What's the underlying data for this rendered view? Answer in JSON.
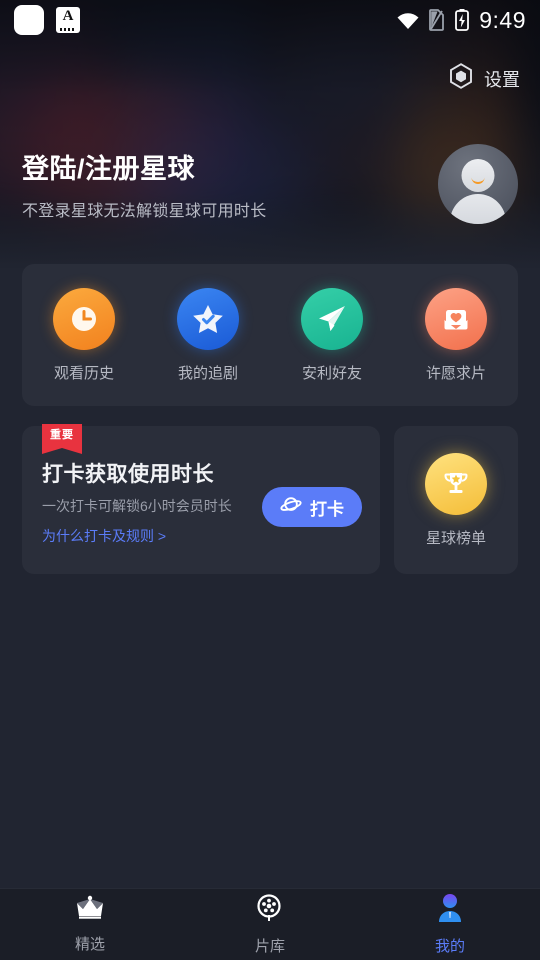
{
  "status_bar": {
    "time": "9:49",
    "icons": [
      "app-white-square-icon",
      "app-a-icon",
      "wifi-icon",
      "sim-off-icon",
      "battery-charging-icon"
    ]
  },
  "header": {
    "settings_label": "设置",
    "settings_icon": "hexagon-gear-icon"
  },
  "login": {
    "title": "登陆/注册星球",
    "subtitle": "不登录星球无法解锁星球可用时长",
    "avatar_icon": "default-avatar-icon"
  },
  "quick_actions": [
    {
      "label": "观看历史",
      "icon": "clock-icon",
      "color": "#f4912a"
    },
    {
      "label": "我的追剧",
      "icon": "star-check-icon",
      "color": "#2a72e8"
    },
    {
      "label": "安利好友",
      "icon": "paper-plane-icon",
      "color": "#25c4a0"
    },
    {
      "label": "许愿求片",
      "icon": "envelope-heart-icon",
      "color": "#f6835c"
    }
  ],
  "checkin": {
    "badge": "重要",
    "title": "打卡获取使用时长",
    "subtitle": "一次打卡可解锁6小时会员时长",
    "link": "为什么打卡及规则 >",
    "button_label": "打卡",
    "button_icon": "planet-icon",
    "button_color": "#5b7cf8"
  },
  "ranking": {
    "label": "星球榜单",
    "icon": "trophy-icon",
    "color": "#f5c53c"
  },
  "tabbar": {
    "items": [
      {
        "label": "精选",
        "icon": "crown-icon",
        "active": false
      },
      {
        "label": "片库",
        "icon": "film-reel-icon",
        "active": false
      },
      {
        "label": "我的",
        "icon": "person-icon",
        "active": true
      }
    ],
    "active_color": "#5b7cf8"
  }
}
